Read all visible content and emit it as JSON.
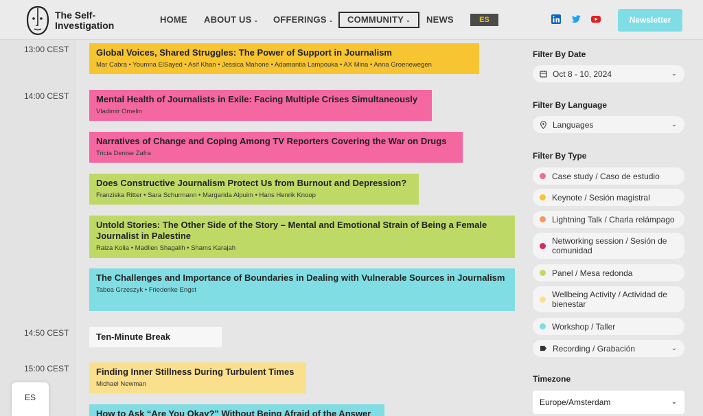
{
  "header": {
    "logo_text_line1": "The Self-",
    "logo_text_line2": "Investigation",
    "nav": [
      "HOME",
      "ABOUT US",
      "OFFERINGS",
      "COMMUNITY",
      "NEWS"
    ],
    "lang": "ES",
    "newsletter": "Newsletter"
  },
  "schedule": {
    "times": [
      "13:00 CEST",
      "14:00 CEST",
      "14:50 CEST",
      "15:00 CEST"
    ],
    "sessions": [
      {
        "title": "Global Voices, Shared Struggles: The Power of Support in Journalism",
        "speakers": "Mar Cabra • Youmna ElSayed • Asif Khan • Jessica Mahone • Adamantia Lampouka • AX Mina • Anna Groenewegen",
        "color": "#f7c531"
      },
      {
        "title": "Mental Health of Journalists in Exile: Facing Multiple Crises Simultaneously",
        "speakers": "Vladimir Omelin",
        "color": "#f467a1"
      },
      {
        "title": "Narratives of Change and Coping Among TV Reporters Covering the War on Drugs",
        "speakers": "Tricia Denise Zafra",
        "color": "#f467a1"
      },
      {
        "title": "Does Constructive Journalism Protect Us from Burnout and Depression?",
        "speakers": "Franziska Ritter • Sara Schurmann • Margarida Alpuim • Hans Henrik Knoop",
        "color": "#bfd966"
      },
      {
        "title": "Untold Stories: The Other Side of the Story – Mental and Emotional Strain of Being a Female Journalist in Palestine",
        "speakers": "Raiza Kolia • Madlien Shagalih • Shams Karajah",
        "color": "#bfd966"
      },
      {
        "title": "The Challenges and Importance of Boundaries in Dealing with Vulnerable Sources in Journalism",
        "speakers": "Tabea Grzeszyk • Friederike Engst",
        "color": "#7fdde3"
      },
      {
        "title": "Ten-Minute Break",
        "speakers": "",
        "color": "#f7f7f7"
      },
      {
        "title": "Finding Inner Stillness During Turbulent Times",
        "speakers": "Michael Newman",
        "color": "#fadf8c"
      },
      {
        "title": "How to Ask “Are You Okay?” Without Being Afraid of the Answer",
        "speakers": "",
        "color": "#7fdde3"
      }
    ]
  },
  "sidebar": {
    "date_label": "Filter By Date",
    "date_value": "Oct 8 - 10, 2024",
    "language_label": "Filter By Language",
    "language_value": "Languages",
    "type_label": "Filter By Type",
    "types": [
      {
        "label": "Case study / Caso de estudio",
        "color": "#f467a1"
      },
      {
        "label": "Keynote / Sesión magistral",
        "color": "#f7c531"
      },
      {
        "label": "Lightning Talk / Charla relámpago",
        "color": "#f59a5b"
      },
      {
        "label": "Networking session / Sesión de comunidad",
        "color": "#d6295f"
      },
      {
        "label": "Panel / Mesa redonda",
        "color": "#bfd966"
      },
      {
        "label": "Wellbeing Activity / Actividad de bienestar",
        "color": "#fadf8c"
      },
      {
        "label": "Workshop / Taller",
        "color": "#7fdde3"
      },
      {
        "label": "Recording / Grabación",
        "color": "#333333"
      }
    ],
    "timezone_label": "Timezone",
    "timezone_value": "Europe/Amsterdam"
  },
  "floating_lang": "ES"
}
